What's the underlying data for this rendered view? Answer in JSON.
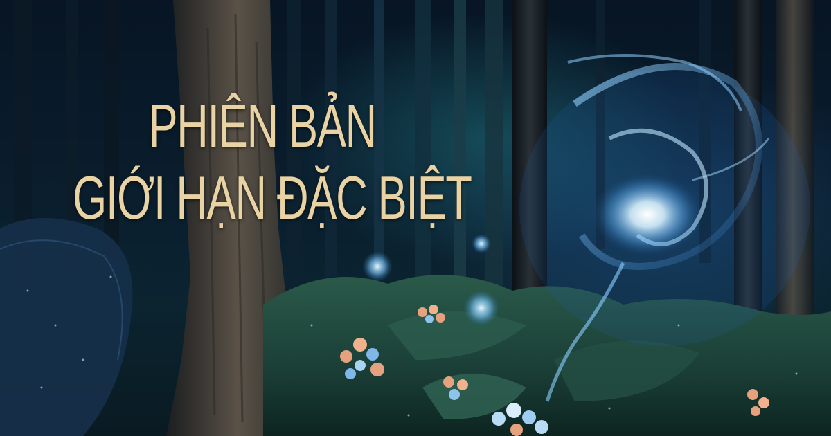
{
  "banner": {
    "headline_line1": "PHIÊN BẢN",
    "headline_line2": "GIỚI HẠN ĐẶC BIỆT"
  },
  "colors": {
    "headline_gold": "#e9d2a3",
    "spirit_glow": "#bfe8ff",
    "forest_dark": "#06101c",
    "moss_green": "#1e4a3a",
    "flower_peach": "#e6a27f"
  },
  "scene": {
    "elements": [
      "forest-background",
      "tree-trunks",
      "moss-ground",
      "glowing-spirit",
      "blossom-clusters",
      "light-orbs"
    ]
  }
}
